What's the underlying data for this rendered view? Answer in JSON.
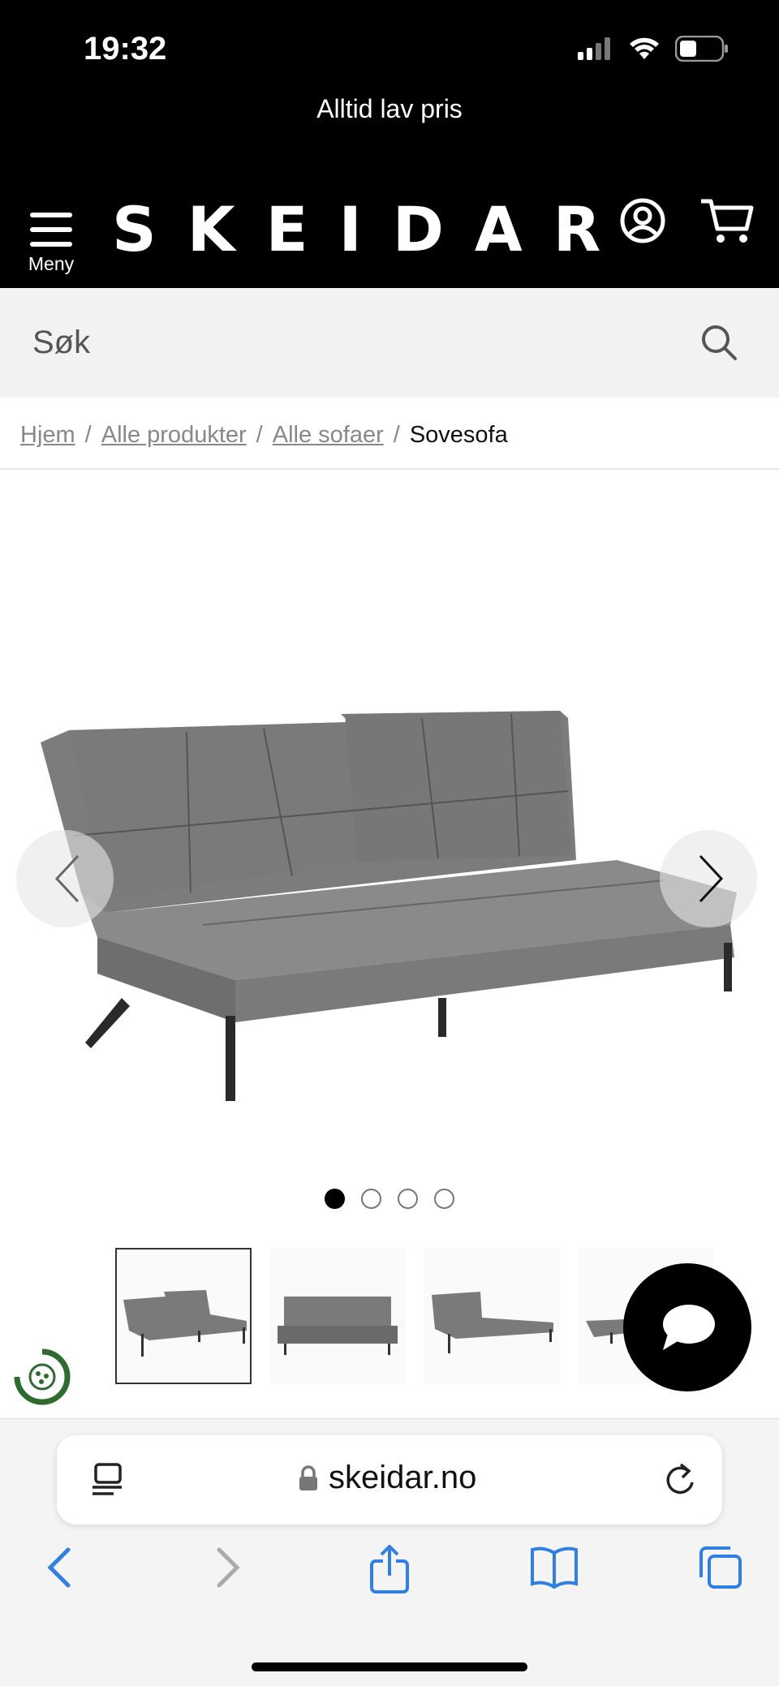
{
  "status_bar": {
    "time": "19:32"
  },
  "promo": {
    "text": "Alltid lav pris"
  },
  "header": {
    "menu_label": "Meny",
    "logo": "SKEIDAR",
    "background": "#000000"
  },
  "search": {
    "placeholder": "Søk"
  },
  "breadcrumb": {
    "items": [
      "Hjem",
      "Alle produkter",
      "Alle sofaer"
    ],
    "separator": "/",
    "current": "Sovesofa"
  },
  "gallery": {
    "image_count": 4,
    "active_index": 0
  },
  "browser": {
    "url": "skeidar.no",
    "accent": "#2f7fe5"
  }
}
